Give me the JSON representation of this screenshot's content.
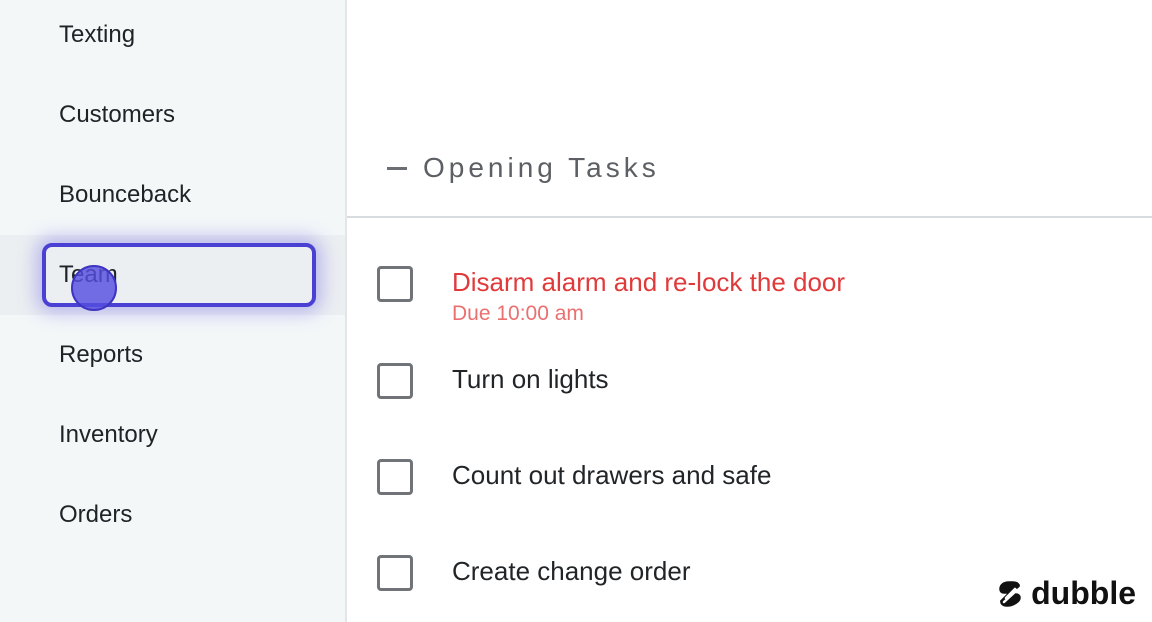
{
  "sidebar": {
    "items": [
      {
        "label": "Texting"
      },
      {
        "label": "Customers"
      },
      {
        "label": "Bounceback"
      },
      {
        "label": "Team",
        "active": true
      },
      {
        "label": "Reports"
      },
      {
        "label": "Inventory"
      },
      {
        "label": "Orders"
      }
    ]
  },
  "section": {
    "title": "Opening Tasks",
    "collapse_icon": "minus-icon"
  },
  "tasks": [
    {
      "label": "Disarm alarm and re-lock the door",
      "due": "Due 10:00 am",
      "overdue": true,
      "checked": false
    },
    {
      "label": "Turn on lights",
      "checked": false
    },
    {
      "label": "Count out drawers and safe",
      "checked": false
    },
    {
      "label": "Create change order",
      "checked": false
    }
  ],
  "watermark": {
    "text": "dubble",
    "icon": "dubble-logo-icon"
  },
  "colors": {
    "accent": "#4a40d4",
    "overdue": "#e03a3a",
    "due_text": "#ea7070",
    "sidebar_bg": "#f4f7f8"
  }
}
